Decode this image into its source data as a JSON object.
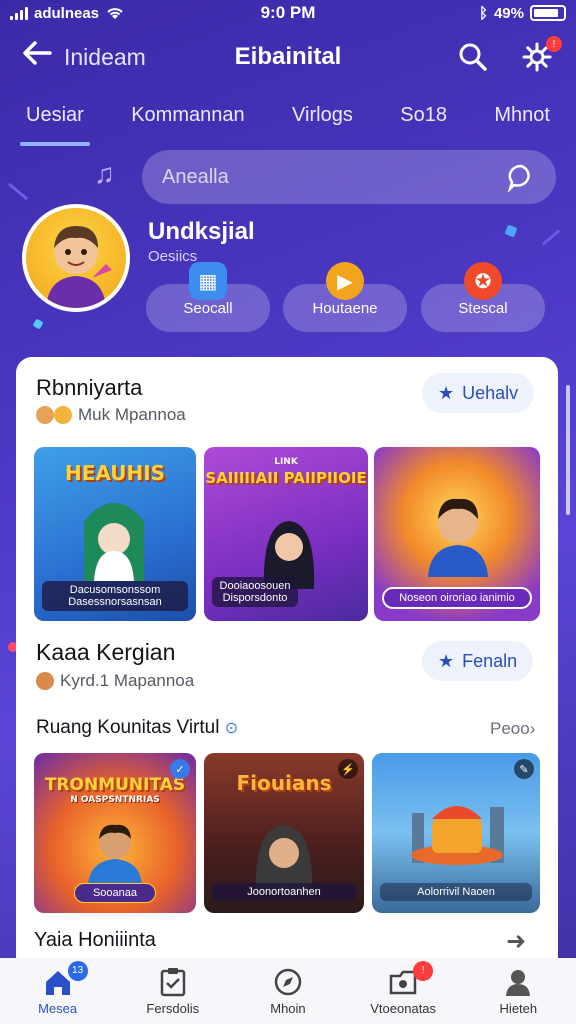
{
  "status_bar": {
    "carrier": "adulneas",
    "time": "9:0 PM",
    "battery": "49%"
  },
  "header": {
    "back_label": "Inideam",
    "title": "Eibainital",
    "notification_count": "!"
  },
  "tabs": [
    {
      "label": "Uesiar",
      "active": true
    },
    {
      "label": "Kommannan",
      "active": false
    },
    {
      "label": "Virlogs",
      "active": false
    },
    {
      "label": "So18",
      "active": false
    },
    {
      "label": "Mhnot",
      "active": false
    }
  ],
  "search": {
    "placeholder": "Anealla"
  },
  "profile": {
    "name": "Undksjial",
    "subtitle": "Oesiics"
  },
  "quick_actions": [
    {
      "label": "Seocall",
      "icon": "calendar-icon"
    },
    {
      "label": "Houtaene",
      "icon": "play-icon"
    },
    {
      "label": "Stescal",
      "icon": "controller-icon"
    }
  ],
  "sections": {
    "featured": {
      "title": "Rbnniyarta",
      "subtitle": "Muk Mpannoa",
      "button_label": "Uehalv",
      "tiles": [
        {
          "heading": "HEAUHIS",
          "banner": "Dacusomsonssom Dasessnorsasnsan"
        },
        {
          "heading": "SAIIIIIAII PAIIPIIOIE",
          "subheading": "LINK",
          "banner": "Dooiaoosouen Disporsdonto"
        },
        {
          "heading": "",
          "banner": "Noseon oiroriao ianimio"
        }
      ]
    },
    "second": {
      "title": "Kaaa Kergian",
      "subtitle": "Kyrd.1 Mapannoa",
      "button_label": "Fenaln"
    },
    "community": {
      "title": "Ruang Kounitas Virtul",
      "see_more": "Peoo",
      "tiles": [
        {
          "heading": "TRONMUNITAS",
          "subheading": "N OASPSNTNRIAS",
          "banner": "Sooanaa"
        },
        {
          "heading": "Fiouians",
          "banner": "Joonortoanhen"
        },
        {
          "heading": "",
          "banner": "Aolorrivil Naoen"
        }
      ]
    },
    "next": {
      "title": "Yaia Honiiinta"
    }
  },
  "bottom_nav": [
    {
      "label": "Mesea",
      "icon": "home-icon",
      "active": true,
      "badge": "13"
    },
    {
      "label": "Fersdolis",
      "icon": "clipboard-icon",
      "active": false,
      "badge": ""
    },
    {
      "label": "Mhoin",
      "icon": "compass-icon",
      "active": false,
      "badge": ""
    },
    {
      "label": "Vtoeonatas",
      "icon": "folder-icon",
      "active": false,
      "badge": "!"
    },
    {
      "label": "Hieteh",
      "icon": "profile-icon",
      "active": false,
      "badge": ""
    }
  ],
  "colors": {
    "background_start": "#3b2aa8",
    "background_end": "#5a45d6",
    "accent_blue": "#2a4fb8",
    "badge_red": "#ff3b3b"
  }
}
